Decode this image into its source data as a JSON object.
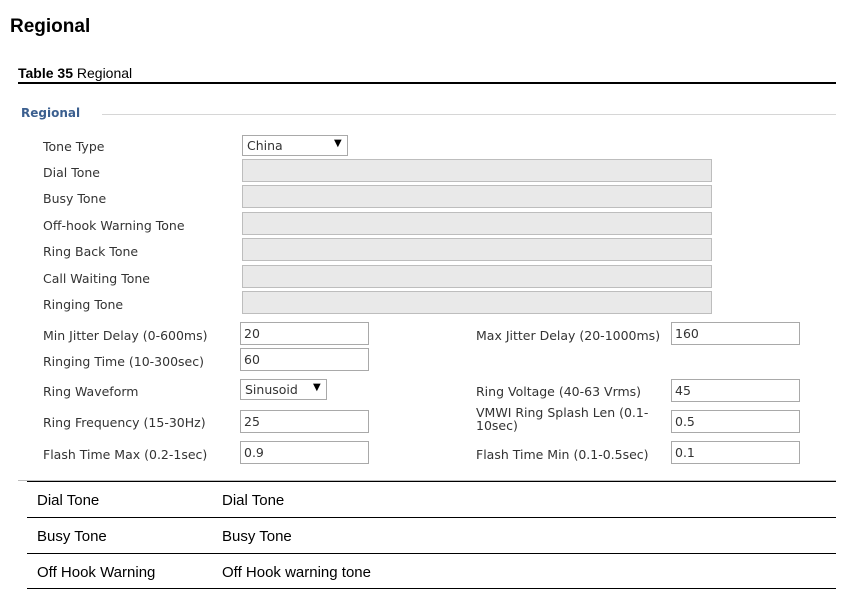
{
  "heading": "Regional",
  "caption": {
    "number": "Table 35",
    "title": "Regional"
  },
  "panel": {
    "legend": "Regional",
    "tone_type": {
      "label": "Tone Type",
      "value": "China",
      "arrow": "▼"
    },
    "tones": [
      {
        "label": "Dial Tone",
        "value": ""
      },
      {
        "label": "Busy Tone",
        "value": ""
      },
      {
        "label": "Off-hook Warning Tone",
        "value": ""
      },
      {
        "label": "Ring Back Tone",
        "value": ""
      },
      {
        "label": "Call Waiting Tone",
        "value": ""
      },
      {
        "label": "Ringing Tone",
        "value": ""
      }
    ],
    "min_jitter": {
      "label": "Min Jitter Delay (0-600ms)",
      "value": "20"
    },
    "max_jitter": {
      "label": "Max Jitter Delay (20-1000ms)",
      "value": "160"
    },
    "ringing_time": {
      "label": "Ringing Time (10-300sec)",
      "value": "60"
    },
    "ring_waveform": {
      "label": "Ring Waveform",
      "value": "Sinusoid",
      "arrow": "▼"
    },
    "ring_voltage": {
      "label": "Ring Voltage (40-63 Vrms)",
      "value": "45"
    },
    "ring_frequency": {
      "label": "Ring Frequency (15-30Hz)",
      "value": "25"
    },
    "vmwi_splash": {
      "label": "VMWI Ring Splash Len (0.1-10sec)",
      "value": "0.5"
    },
    "flash_max": {
      "label": "Flash Time Max (0.2-1sec)",
      "value": "0.9"
    },
    "flash_min": {
      "label": "Flash Time Min (0.1-0.5sec)",
      "value": "0.1"
    }
  },
  "definitions": [
    {
      "term": "Dial Tone",
      "description": "Dial Tone"
    },
    {
      "term": "Busy Tone",
      "description": "Busy Tone"
    },
    {
      "term": "Off Hook Warning",
      "description": "Off Hook warning tone"
    }
  ]
}
